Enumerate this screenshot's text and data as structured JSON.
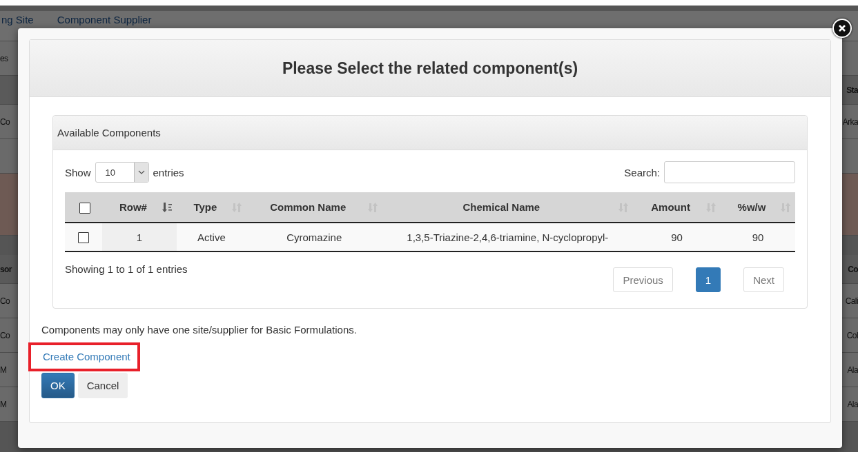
{
  "background": {
    "rows": [
      {
        "kind": "tabs",
        "left": "ng Site",
        "right": "Component Supplier"
      },
      {
        "kind": "row",
        "left": "es",
        "right": ""
      },
      {
        "kind": "header",
        "left": "",
        "right": "Sta"
      },
      {
        "kind": "row",
        "left": "Co",
        "right": "Arka"
      },
      {
        "kind": "row",
        "left": "",
        "right": ""
      },
      {
        "kind": "highlight",
        "left": "",
        "right": ""
      },
      {
        "kind": "header",
        "left": "sor",
        "right": "Co"
      },
      {
        "kind": "row",
        "left": "Co",
        "right": "Cali"
      },
      {
        "kind": "row",
        "left": "Co",
        "right": "Col"
      },
      {
        "kind": "row",
        "left": "M",
        "right": "Ala"
      },
      {
        "kind": "row",
        "left": "M",
        "right": "Ala"
      }
    ]
  },
  "dialog": {
    "title": "Please Select the related component(s)",
    "panel": {
      "title": "Available Components",
      "show_label": "Show",
      "length_value": "10",
      "entries_label": "entries",
      "search_label": "Search:",
      "select_all_checked": false,
      "columns": [
        {
          "label": "Row#",
          "sorted": true
        },
        {
          "label": "Type",
          "sorted": false
        },
        {
          "label": "Common Name",
          "sorted": false
        },
        {
          "label": "Chemical Name",
          "sorted": false
        },
        {
          "label": "Amount",
          "sorted": false
        },
        {
          "label": "%w/w",
          "sorted": false
        }
      ],
      "rows": [
        {
          "checked": false,
          "cells": [
            "1",
            "Active",
            "Cyromazine",
            "1,3,5-Triazine-2,4,6-triamine, N-cyclopropyl-",
            "90",
            "90"
          ]
        }
      ],
      "info": "Showing 1 to 1 of 1 entries",
      "pagination": {
        "previous": {
          "label": "Previous",
          "disabled": true
        },
        "pages": [
          {
            "label": "1",
            "selected": true
          }
        ],
        "next": {
          "label": "Next",
          "disabled": true
        }
      }
    },
    "note": "Components may only have one site/supplier for Basic Formulations.",
    "create_link": {
      "label": "Create Component",
      "highlighted": true
    },
    "buttons": [
      {
        "label": "OK",
        "kind": "primary"
      },
      {
        "label": "Cancel",
        "kind": "default"
      }
    ]
  }
}
